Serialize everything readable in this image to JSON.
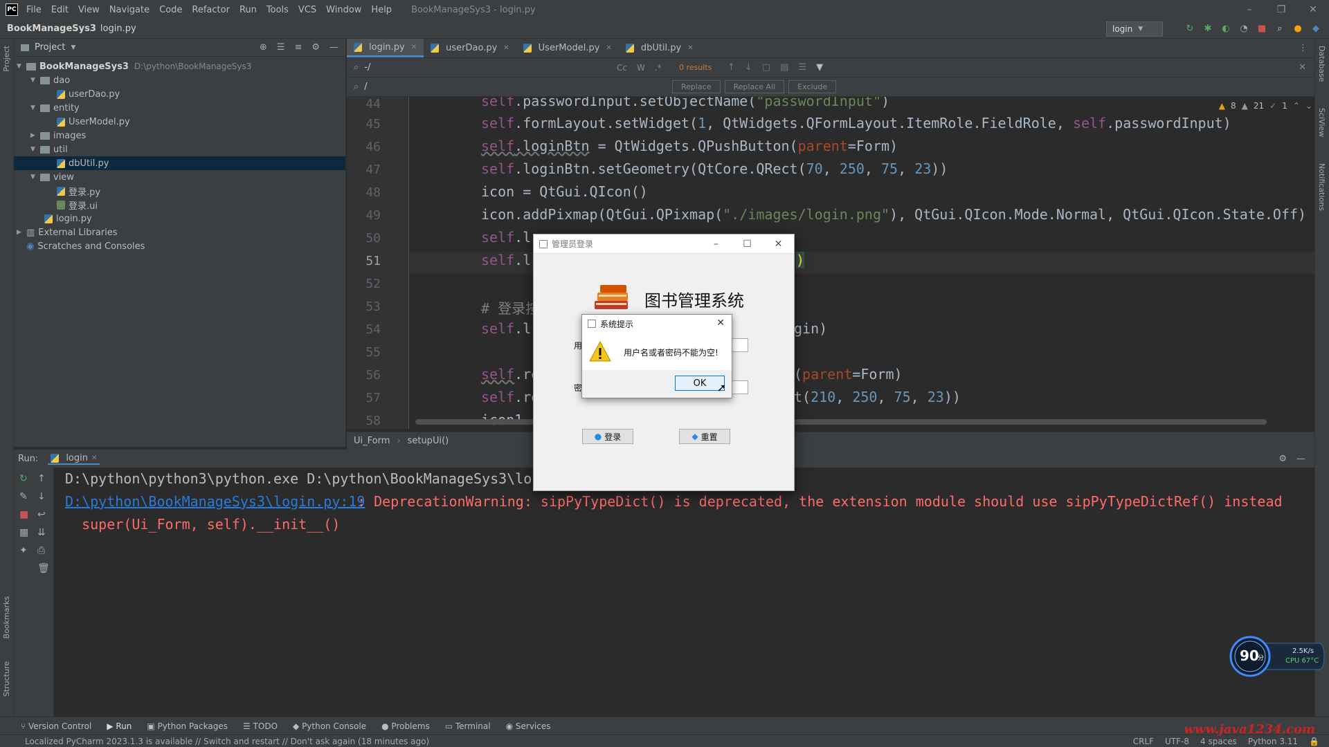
{
  "app": {
    "logo": "PC",
    "window_title": "BookManageSys3 - login.py",
    "menu": [
      "File",
      "Edit",
      "View",
      "Navigate",
      "Code",
      "Refactor",
      "Run",
      "Tools",
      "VCS",
      "Window",
      "Help"
    ]
  },
  "navbar": {
    "project": "BookManageSys3",
    "file": "login.py",
    "run_config": "login"
  },
  "project_panel": {
    "title": "Project",
    "root_name": "BookManageSys3",
    "root_path": "D:\\python\\BookManageSys3",
    "items": [
      {
        "label": "dao",
        "type": "folder"
      },
      {
        "label": "userDao.py",
        "type": "py"
      },
      {
        "label": "entity",
        "type": "folder"
      },
      {
        "label": "UserModel.py",
        "type": "py"
      },
      {
        "label": "images",
        "type": "folder"
      },
      {
        "label": "util",
        "type": "folder"
      },
      {
        "label": "dbUtil.py",
        "type": "py"
      },
      {
        "label": "view",
        "type": "folder"
      },
      {
        "label": "登录.py",
        "type": "py"
      },
      {
        "label": "登录.ui",
        "type": "ui"
      },
      {
        "label": "login.py",
        "type": "py"
      },
      {
        "label": "External Libraries",
        "type": "lib"
      },
      {
        "label": "Scratches and Consoles",
        "type": "scratch"
      }
    ]
  },
  "editor": {
    "tabs": [
      "login.py",
      "userDao.py",
      "UserModel.py",
      "dbUtil.py"
    ],
    "search_query": "-/",
    "replace_query": "/",
    "search_results": "0 results",
    "search_opts": [
      "Cc",
      "W",
      ".*"
    ],
    "replace_buttons": [
      "Replace",
      "Replace All",
      "Exclude"
    ],
    "inspections": {
      "warnings": "8",
      "weak": "21",
      "ok": "1"
    },
    "line_numbers": [
      "44",
      "45",
      "46",
      "47",
      "48",
      "49",
      "50",
      "51",
      "52",
      "53",
      "54",
      "55",
      "56",
      "57",
      "58"
    ],
    "current_line": "51",
    "breadcrumb": [
      "Ui_Form",
      "setupUi()"
    ]
  },
  "run_panel": {
    "label": "Run:",
    "tab": "login",
    "console": [
      "D:\\python\\python3\\python.exe D:\\python\\BookManageSys3\\lo",
      "D:\\python\\BookManageSys3\\login.py:19",
      ": DeprecationWarning: sipPyTypeDict() is deprecated, the extension module should use sipPyTypeDictRef() instead",
      "  super(Ui_Form, self).__init__()"
    ]
  },
  "login_window": {
    "title": "管理员登录",
    "heading": "图书管理系统",
    "user_label_partial": "用",
    "pwd_label_partial": "密",
    "login_button": "登录",
    "reset_button": "重置"
  },
  "message_box": {
    "title": "系统提示",
    "message": "用户名或者密码不能为空!",
    "ok": "OK"
  },
  "tool_tabs": [
    "Version Control",
    "Run",
    "Python Packages",
    "TODO",
    "Python Console",
    "Problems",
    "Terminal",
    "Services"
  ],
  "status": {
    "message": "Localized PyCharm 2023.1.3 is available // Switch and restart // Don't ask again (18 minutes ago)",
    "crlf": "CRLF",
    "encoding": "UTF-8",
    "indent": "4 spaces",
    "interpreter": "Python 3.11"
  },
  "monitor": {
    "score": "90",
    "unit": "分",
    "net": "2.5K/s",
    "cpu": "CPU 67°C"
  },
  "watermark": "www.java1234.com",
  "side_strips": {
    "left": [
      "Project",
      "Bookmarks",
      "Structure"
    ],
    "right": [
      "Database",
      "SciView",
      "Notifications"
    ]
  },
  "colors": {
    "accent": "#4a88c7",
    "error_text": "#ff6b68",
    "link": "#287bde",
    "warning": "#e5a50a"
  }
}
